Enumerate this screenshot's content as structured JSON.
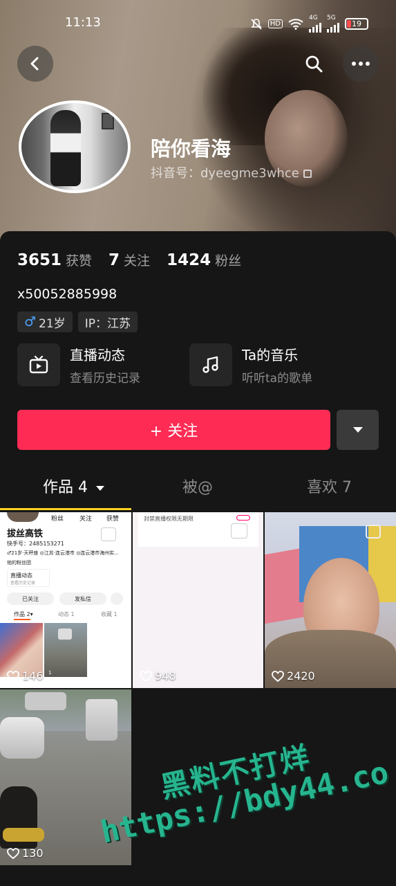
{
  "status_bar": {
    "time": "11:13",
    "network_a": "4G",
    "network_b": "5G",
    "hd_label": "HD",
    "battery": "19"
  },
  "profile": {
    "nickname": "陪你看海",
    "douyin_id_label": "抖音号：dyeegme3whce",
    "bio": "x50052885998",
    "tags": [
      {
        "icon": "male-icon",
        "text": "21岁"
      },
      {
        "text": "IP：江苏"
      }
    ]
  },
  "stats": [
    {
      "num": "3651",
      "label": "获赞"
    },
    {
      "num": "7",
      "label": "关注"
    },
    {
      "num": "1424",
      "label": "粉丝"
    }
  ],
  "features": [
    {
      "icon": "tv-icon",
      "title": "直播动态",
      "subtitle": "查看历史记录"
    },
    {
      "icon": "music-icon",
      "title": "Ta的音乐",
      "subtitle": "听听ta的歌单"
    }
  ],
  "actions": {
    "follow_label": "+ 关注"
  },
  "tabs": [
    {
      "label": "作品 4"
    },
    {
      "label": "被@"
    },
    {
      "label": "喜欢 7"
    }
  ],
  "grid": [
    {
      "likes": "146"
    },
    {
      "likes": "948"
    },
    {
      "likes": "2420"
    },
    {
      "likes": "130"
    }
  ],
  "mini_profile": {
    "name": "拔丝高铁",
    "id": "快手号：2485153271",
    "labels": [
      "粉丝",
      "关注",
      "获赞"
    ],
    "info": "♂21岁·天秤座   ◎江苏·连云港市   ◎连云港市海州实...",
    "group": "他的粉丝团",
    "live_title": "直播动态",
    "live_sub": "查看历史记录",
    "followed": "已关注",
    "message": "发私信",
    "tab_works": "作品 2▾",
    "tab_moments": "动态 1",
    "tab_fav": "收藏 1",
    "thumb_likes": "1"
  },
  "banned_notice": "封禁直播权限无期限",
  "watermark": {
    "line1": "黑料不打烊",
    "line2": "https://bdy44.co"
  }
}
